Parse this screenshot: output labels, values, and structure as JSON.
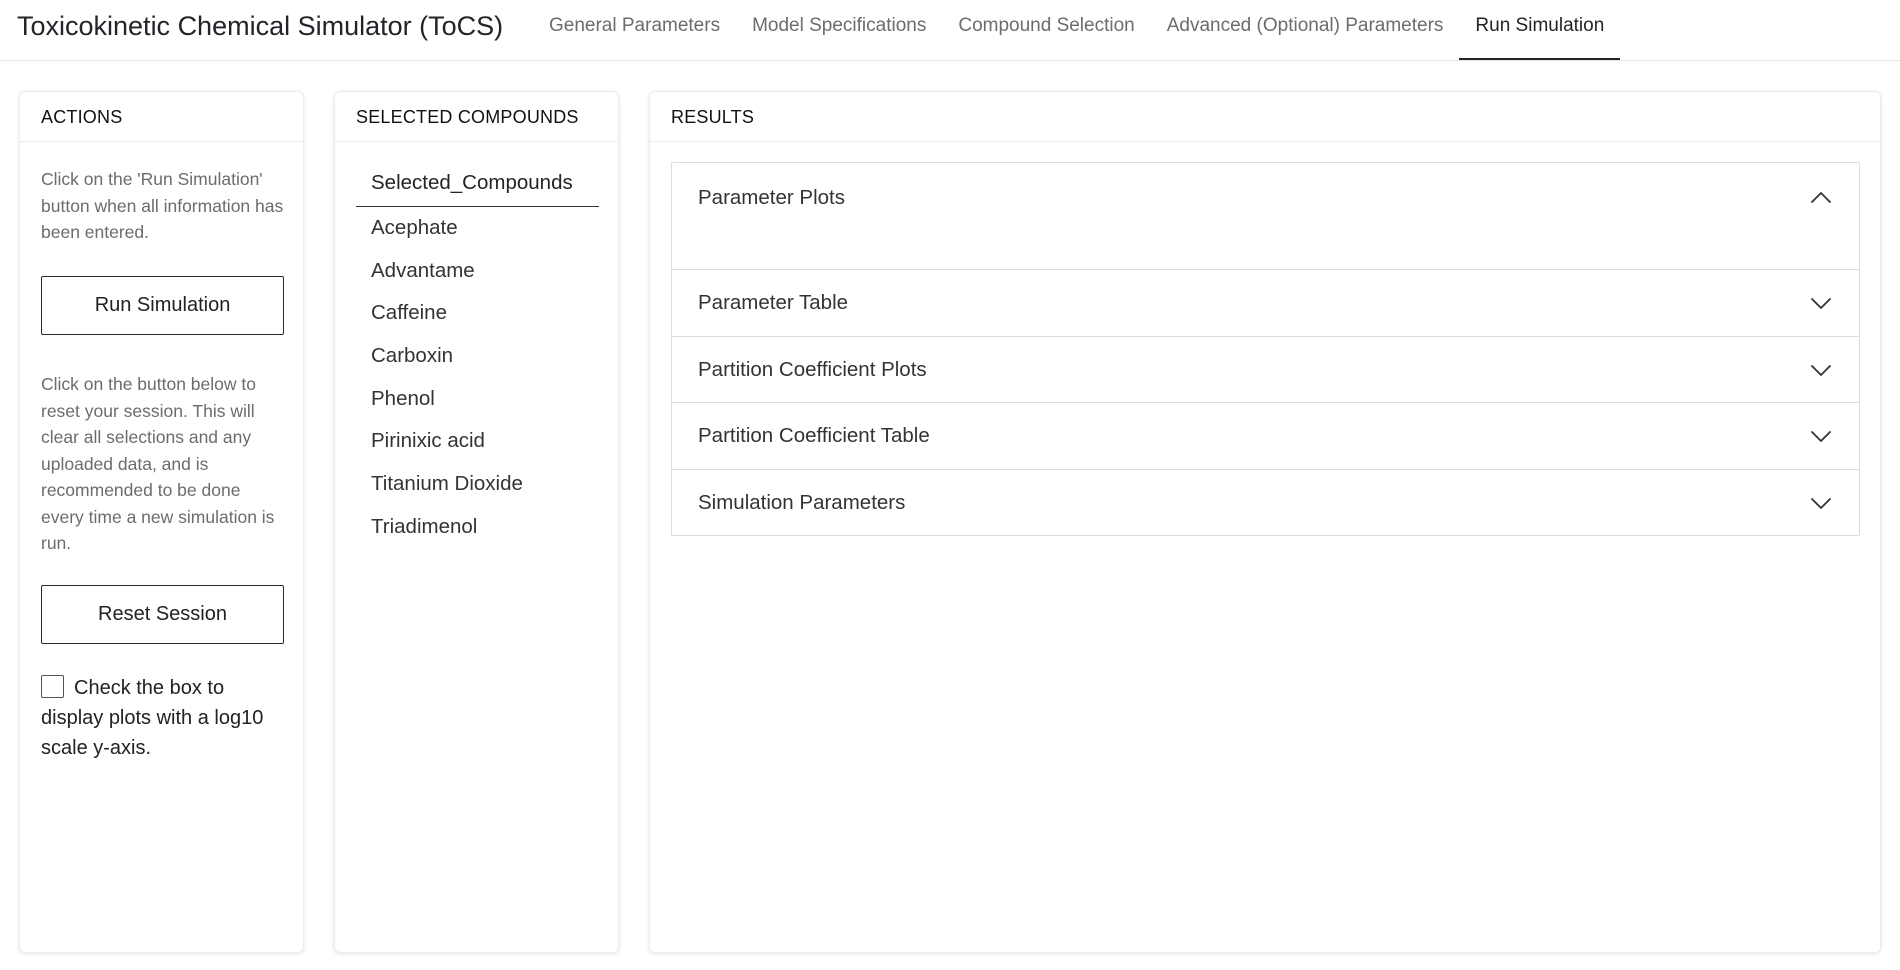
{
  "app": {
    "title": "Toxicokinetic Chemical Simulator (ToCS)"
  },
  "nav": {
    "tabs": [
      {
        "label": "General Parameters"
      },
      {
        "label": "Model Specifications"
      },
      {
        "label": "Compound Selection"
      },
      {
        "label": "Advanced (Optional) Parameters"
      },
      {
        "label": "Run Simulation",
        "active": true
      }
    ]
  },
  "actions": {
    "header": "ACTIONS",
    "run_help": "Click on the 'Run Simulation' button when all information has been entered.",
    "run_button": "Run Simulation",
    "reset_help": "Click on the button below to reset your session. This will clear all selections and any uploaded data, and is recommended to be done every time a new simulation is run.",
    "reset_button": "Reset Session",
    "log_checkbox_label": "Check the box to display plots with a log10 scale y-axis.",
    "log_checkbox_checked": false
  },
  "compounds": {
    "header": "SELECTED COMPOUNDS",
    "column_header": "Selected_Compounds",
    "items": [
      "Acephate",
      "Advantame",
      "Caffeine",
      "Carboxin",
      "Phenol",
      "Pirinixic acid",
      "Titanium Dioxide",
      "Triadimenol"
    ]
  },
  "results": {
    "header": "RESULTS",
    "panels": [
      {
        "title": "Parameter Plots",
        "expanded": true,
        "icon": "chevron-up-icon"
      },
      {
        "title": "Parameter Table",
        "expanded": false,
        "icon": "chevron-down-icon"
      },
      {
        "title": "Partition Coefficient Plots",
        "expanded": false,
        "icon": "chevron-down-icon"
      },
      {
        "title": "Partition Coefficient Table",
        "expanded": false,
        "icon": "chevron-down-icon"
      },
      {
        "title": "Simulation Parameters",
        "expanded": false,
        "icon": "chevron-down-icon"
      }
    ]
  }
}
